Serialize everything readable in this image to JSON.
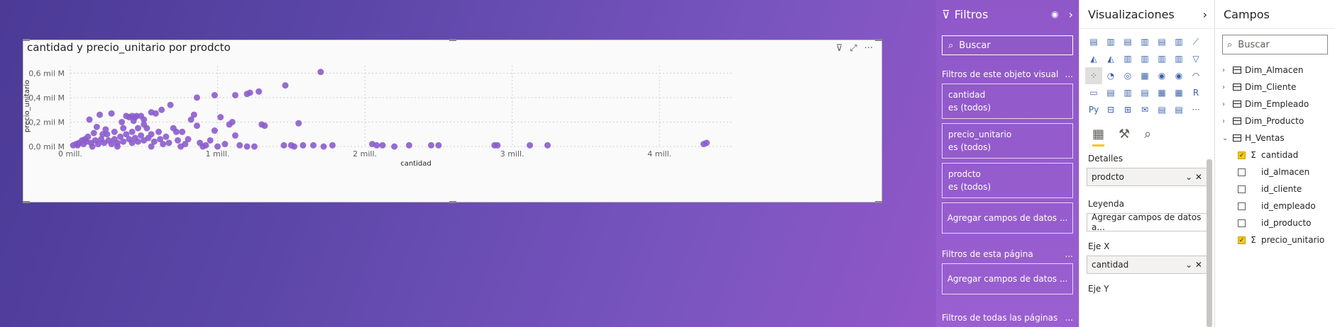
{
  "visual": {
    "title": "cantidad y precio_unitario por prodcto",
    "icons": [
      "filter-icon",
      "focus-mode-icon",
      "more-options-icon"
    ]
  },
  "chart_data": {
    "type": "scatter",
    "title": "cantidad y precio_unitario por prodcto",
    "xlabel": "cantidad",
    "ylabel": "precio_unitario",
    "xlim": [
      0,
      4.5
    ],
    "ylim": [
      0,
      0.66
    ],
    "x_ticks": [
      0,
      1,
      2,
      3,
      4
    ],
    "x_tick_labels": [
      "0 mill.",
      "1 mill.",
      "2 mill.",
      "3 mill.",
      "4 mill."
    ],
    "y_ticks": [
      0,
      0.2,
      0.4,
      0.6
    ],
    "y_tick_labels": [
      "0,0 mil M",
      "0,2 mil M",
      "0,4 mil M",
      "0,6 mil M"
    ],
    "grid": true,
    "point_color": "#8c5ccc",
    "points": [
      [
        1.7,
        0.61
      ],
      [
        1.46,
        0.5
      ],
      [
        1.28,
        0.45
      ],
      [
        1.22,
        0.44
      ],
      [
        1.2,
        0.43
      ],
      [
        1.12,
        0.42
      ],
      [
        0.98,
        0.42
      ],
      [
        0.86,
        0.4
      ],
      [
        0.68,
        0.34
      ],
      [
        0.62,
        0.3
      ],
      [
        0.58,
        0.27
      ],
      [
        0.55,
        0.28
      ],
      [
        0.48,
        0.25
      ],
      [
        0.45,
        0.25
      ],
      [
        0.42,
        0.25
      ],
      [
        0.4,
        0.24
      ],
      [
        0.38,
        0.25
      ],
      [
        0.44,
        0.24
      ],
      [
        0.28,
        0.27
      ],
      [
        0.2,
        0.26
      ],
      [
        0.13,
        0.22
      ],
      [
        0.18,
        0.16
      ],
      [
        0.35,
        0.2
      ],
      [
        0.5,
        0.18
      ],
      [
        0.52,
        0.15
      ],
      [
        0.6,
        0.12
      ],
      [
        0.7,
        0.15
      ],
      [
        0.84,
        0.26
      ],
      [
        0.82,
        0.22
      ],
      [
        0.86,
        0.17
      ],
      [
        1.02,
        0.24
      ],
      [
        1.1,
        0.2
      ],
      [
        1.08,
        0.18
      ],
      [
        0.98,
        0.13
      ],
      [
        1.12,
        0.09
      ],
      [
        1.3,
        0.18
      ],
      [
        1.32,
        0.17
      ],
      [
        1.55,
        0.19
      ],
      [
        0.72,
        0.12
      ],
      [
        0.76,
        0.12
      ],
      [
        0.65,
        0.08
      ],
      [
        0.55,
        0.1
      ],
      [
        0.42,
        0.12
      ],
      [
        0.46,
        0.15
      ],
      [
        0.3,
        0.12
      ],
      [
        0.25,
        0.1
      ],
      [
        0.22,
        0.1
      ],
      [
        0.16,
        0.11
      ],
      [
        0.12,
        0.08
      ],
      [
        0.1,
        0.06
      ],
      [
        0.08,
        0.05
      ],
      [
        0.06,
        0.03
      ],
      [
        0.04,
        0.02
      ],
      [
        0.02,
        0.01
      ],
      [
        0.05,
        0.01
      ],
      [
        0.09,
        0.02
      ],
      [
        0.11,
        0.04
      ],
      [
        0.14,
        0.03
      ],
      [
        0.17,
        0.05
      ],
      [
        0.19,
        0.02
      ],
      [
        0.21,
        0.06
      ],
      [
        0.23,
        0.03
      ],
      [
        0.26,
        0.05
      ],
      [
        0.28,
        0.02
      ],
      [
        0.3,
        0.06
      ],
      [
        0.32,
        0.03
      ],
      [
        0.34,
        0.08
      ],
      [
        0.36,
        0.04
      ],
      [
        0.38,
        0.1
      ],
      [
        0.4,
        0.06
      ],
      [
        0.42,
        0.03
      ],
      [
        0.44,
        0.07
      ],
      [
        0.46,
        0.04
      ],
      [
        0.48,
        0.09
      ],
      [
        0.5,
        0.05
      ],
      [
        0.53,
        0.07
      ],
      [
        0.57,
        0.04
      ],
      [
        0.61,
        0.06
      ],
      [
        0.63,
        0.02
      ],
      [
        0.67,
        0.03
      ],
      [
        0.73,
        0.05
      ],
      [
        0.78,
        0.02
      ],
      [
        0.8,
        0.06
      ],
      [
        0.88,
        0.03
      ],
      [
        0.92,
        0.01
      ],
      [
        0.95,
        0.05
      ],
      [
        1.05,
        0.02
      ],
      [
        1.15,
        0.01
      ],
      [
        1.2,
        0.0
      ],
      [
        1.25,
        0.0
      ],
      [
        1.45,
        0.01
      ],
      [
        1.5,
        0.01
      ],
      [
        1.52,
        0.0
      ],
      [
        1.58,
        0.01
      ],
      [
        1.65,
        0.01
      ],
      [
        1.72,
        0.0
      ],
      [
        1.78,
        0.01
      ],
      [
        2.05,
        0.02
      ],
      [
        2.08,
        0.01
      ],
      [
        2.12,
        0.01
      ],
      [
        2.2,
        0.0
      ],
      [
        2.3,
        0.01
      ],
      [
        2.45,
        0.01
      ],
      [
        2.5,
        0.01
      ],
      [
        2.88,
        0.01
      ],
      [
        2.9,
        0.01
      ],
      [
        3.12,
        0.01
      ],
      [
        3.24,
        0.01
      ],
      [
        4.3,
        0.02
      ],
      [
        4.32,
        0.03
      ],
      [
        0.15,
        0.0
      ],
      [
        0.32,
        0.0
      ],
      [
        0.55,
        0.0
      ],
      [
        0.75,
        0.0
      ],
      [
        0.9,
        0.0
      ],
      [
        1.0,
        0.0
      ],
      [
        0.36,
        0.15
      ],
      [
        0.24,
        0.14
      ],
      [
        0.5,
        0.22
      ],
      [
        0.43,
        0.21
      ]
    ]
  },
  "filters": {
    "title": "Filtros",
    "search_placeholder": "Buscar",
    "section_visual": "Filtros de este objeto visual",
    "cards": [
      {
        "name": "cantidad",
        "state": "es (todos)"
      },
      {
        "name": "precio_unitario",
        "state": "es (todos)"
      },
      {
        "name": "prodcto",
        "state": "es (todos)"
      }
    ],
    "add_fields": "Agregar campos de datos ...",
    "section_page": "Filtros de esta página",
    "add_fields_page": "Agregar campos de datos ...",
    "section_all": "Filtros de todas las páginas",
    "more": "..."
  },
  "visualizations": {
    "title": "Visualizaciones",
    "icons": [
      "stacked-bar-icon",
      "stacked-column-icon",
      "clustered-bar-icon",
      "clustered-column-icon",
      "100-bar-icon",
      "100-column-icon",
      "line-chart-icon",
      "area-chart-icon",
      "stacked-area-icon",
      "line-column-icon",
      "line-column-2-icon",
      "ribbon-chart-icon",
      "waterfall-icon",
      "funnel-icon",
      "scatter-icon",
      "pie-icon",
      "donut-icon",
      "treemap-icon",
      "map-icon",
      "filled-map-icon",
      "gauge-icon",
      "card-icon",
      "multirow-card-icon",
      "kpi-icon",
      "slicer-icon",
      "table-icon",
      "matrix-icon",
      "r-visual-icon",
      "python-visual-icon",
      "key-influencers-icon",
      "decomposition-tree-icon",
      "qa-icon",
      "narrative-icon",
      "paginated-icon",
      "more-visuals-icon"
    ],
    "icon_glyphs": [
      "▤",
      "▥",
      "▤",
      "▥",
      "▤",
      "▥",
      "⟋",
      "◭",
      "◭",
      "▥",
      "▥",
      "▥",
      "▥",
      "▽",
      "⁘",
      "◔",
      "◎",
      "▦",
      "◉",
      "◉",
      "◠",
      "▭",
      "▤",
      "▥",
      "▤",
      "▦",
      "▦",
      "R",
      "Py",
      "⊟",
      "⊞",
      "✉",
      "▤",
      "▤",
      "···"
    ],
    "r_label": "R",
    "py_label": "Py",
    "wells": {
      "detalles_label": "Detalles",
      "detalles_value": "prodcto",
      "leyenda_label": "Leyenda",
      "leyenda_value": "Agregar campos de datos a...",
      "ejex_label": "Eje X",
      "ejex_value": "cantidad",
      "ejey_label": "Eje Y"
    }
  },
  "fields": {
    "title": "Campos",
    "search_placeholder": "Buscar",
    "tables": [
      {
        "name": "Dim_Almacen",
        "expanded": false,
        "has_check": false
      },
      {
        "name": "Dim_Cliente",
        "expanded": false,
        "has_check": false
      },
      {
        "name": "Dim_Empleado",
        "expanded": false,
        "has_check": false
      },
      {
        "name": "Dim_Producto",
        "expanded": false,
        "has_check": true
      },
      {
        "name": "H_Ventas",
        "expanded": true,
        "has_check": true
      }
    ],
    "h_ventas_fields": [
      {
        "name": "cantidad",
        "checked": true,
        "sigma": true
      },
      {
        "name": "id_almacen",
        "checked": false,
        "sigma": false
      },
      {
        "name": "id_cliente",
        "checked": false,
        "sigma": false
      },
      {
        "name": "id_empleado",
        "checked": false,
        "sigma": false
      },
      {
        "name": "id_producto",
        "checked": false,
        "sigma": false
      },
      {
        "name": "precio_unitario",
        "checked": true,
        "sigma": true
      }
    ]
  }
}
